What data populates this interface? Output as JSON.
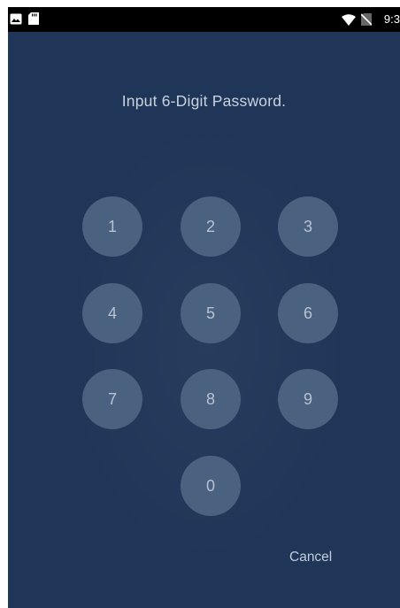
{
  "status_bar": {
    "time": "9:3",
    "icons": [
      "image-notification-icon",
      "sd-card-icon",
      "wifi-icon",
      "no-sim-icon"
    ]
  },
  "title": "Input 6-Digit Password.",
  "keypad": {
    "keys": [
      "1",
      "2",
      "3",
      "4",
      "5",
      "6",
      "7",
      "8",
      "9",
      "0"
    ]
  },
  "cancel_label": "Cancel",
  "colors": {
    "background": "#1f3658",
    "key_fill": "#4b6180",
    "status_bar": "#000000"
  }
}
